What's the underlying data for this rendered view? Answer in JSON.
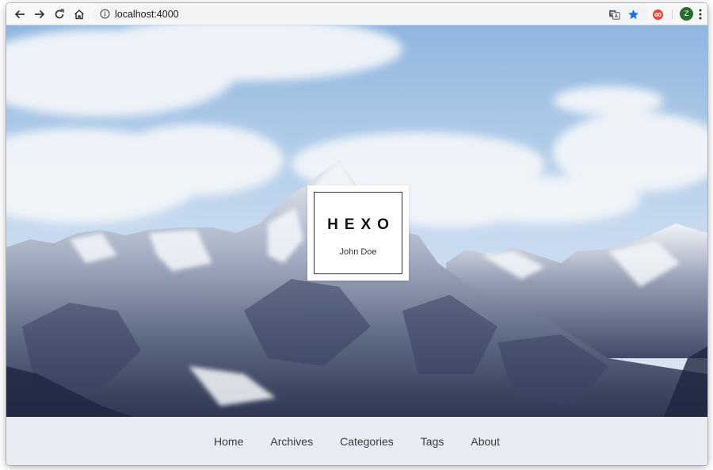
{
  "browser": {
    "url": "localhost:4000",
    "profile_initial": "Z",
    "icons": {
      "back": "arrow-left-icon",
      "forward": "arrow-right-icon",
      "reload": "reload-icon",
      "home": "home-icon",
      "info": "info-icon",
      "translate": "translate-icon",
      "bookmark": "star-icon",
      "extension": "infinity-icon",
      "menu": "kebab-menu-icon"
    },
    "colors": {
      "bookmark_star": "#1a73e8",
      "extension": "#e8453c",
      "avatar": "#2a6b2f"
    }
  },
  "site": {
    "title": "HEXO",
    "author": "John Doe"
  },
  "nav": {
    "items": [
      {
        "label": "Home"
      },
      {
        "label": "Archives"
      },
      {
        "label": "Categories"
      },
      {
        "label": "Tags"
      },
      {
        "label": "About"
      }
    ]
  }
}
